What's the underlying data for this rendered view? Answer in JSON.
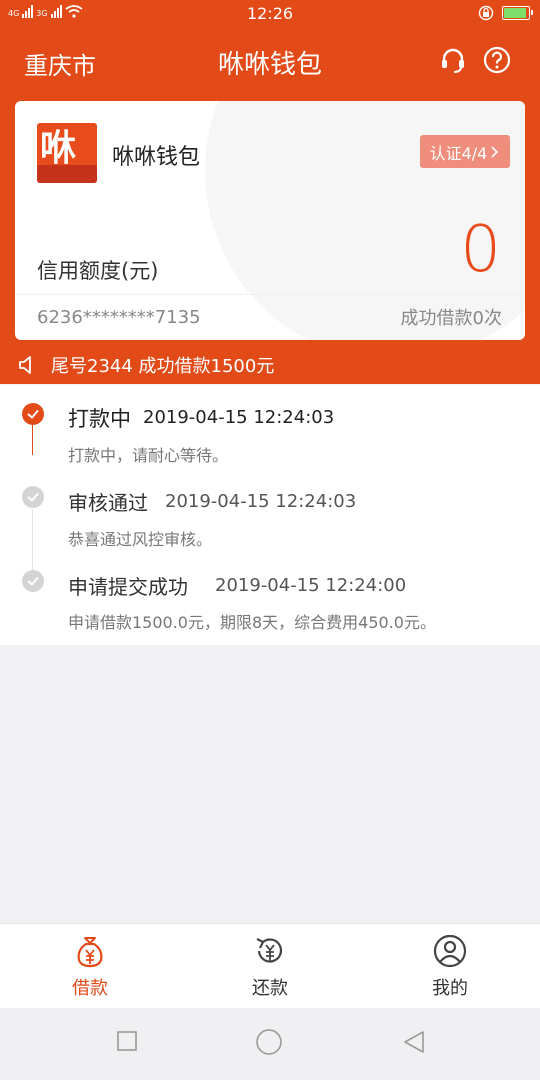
{
  "status_bar": {
    "network_labels": [
      "4G",
      "3G"
    ],
    "time": "12:26"
  },
  "header": {
    "city": "重庆市",
    "title": "咻咻钱包",
    "icons": [
      "headset-icon",
      "help-icon"
    ]
  },
  "card": {
    "logo_text": "咻",
    "name": "咻咻钱包",
    "cert_badge": "认证4/4",
    "credit_label": "信用额度(元)",
    "credit_value": "0",
    "card_number": "6236********7135",
    "loan_count": "成功借款0次"
  },
  "ticker": {
    "text": "尾号2344 成功借款1500元"
  },
  "timeline": [
    {
      "title": "打款中",
      "time": "2019-04-15 12:24:03",
      "desc": "打款中，请耐心等待。",
      "active": true
    },
    {
      "title": "审核通过",
      "time": "2019-04-15 12:24:03",
      "desc": "恭喜通过风控审核。",
      "active": false
    },
    {
      "title": "申请提交成功",
      "time": "2019-04-15 12:24:00",
      "desc": "申请借款1500.0元，期限8天，综合费用450.0元。",
      "active": false
    }
  ],
  "tabs": [
    {
      "label": "借款",
      "icon": "money-bag-icon",
      "active": true
    },
    {
      "label": "还款",
      "icon": "repay-icon",
      "active": false
    },
    {
      "label": "我的",
      "icon": "user-icon",
      "active": false
    }
  ],
  "colors": {
    "brand": "#e24a18",
    "badge": "#ef8e7c",
    "inactive_dot": "#cfcfcf"
  }
}
